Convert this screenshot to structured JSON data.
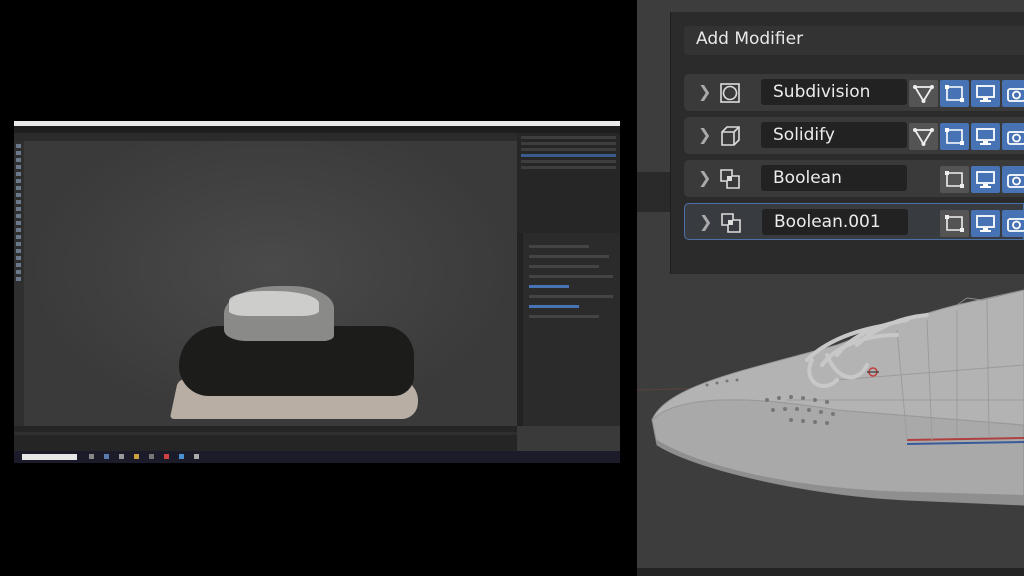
{
  "modifier_panel": {
    "add_modifier_label": "Add Modifier",
    "modifiers": [
      {
        "name": "Subdivision",
        "icon": "subdivision-icon",
        "expanded": false,
        "active": false
      },
      {
        "name": "Solidify",
        "icon": "solidify-icon",
        "expanded": false,
        "active": false
      },
      {
        "name": "Boolean",
        "icon": "boolean-icon",
        "expanded": false,
        "active": false
      },
      {
        "name": "Boolean.001",
        "icon": "boolean-icon",
        "expanded": false,
        "active": true
      }
    ],
    "toggle_icons": [
      "on-cage-icon",
      "edit-mode-icon",
      "realtime-viewport-icon",
      "render-camera-icon"
    ]
  },
  "colors": {
    "accent_blue": "#4772b3",
    "panel_bg": "#2b2b2b",
    "viewport_bg": "#3d3d3d"
  }
}
